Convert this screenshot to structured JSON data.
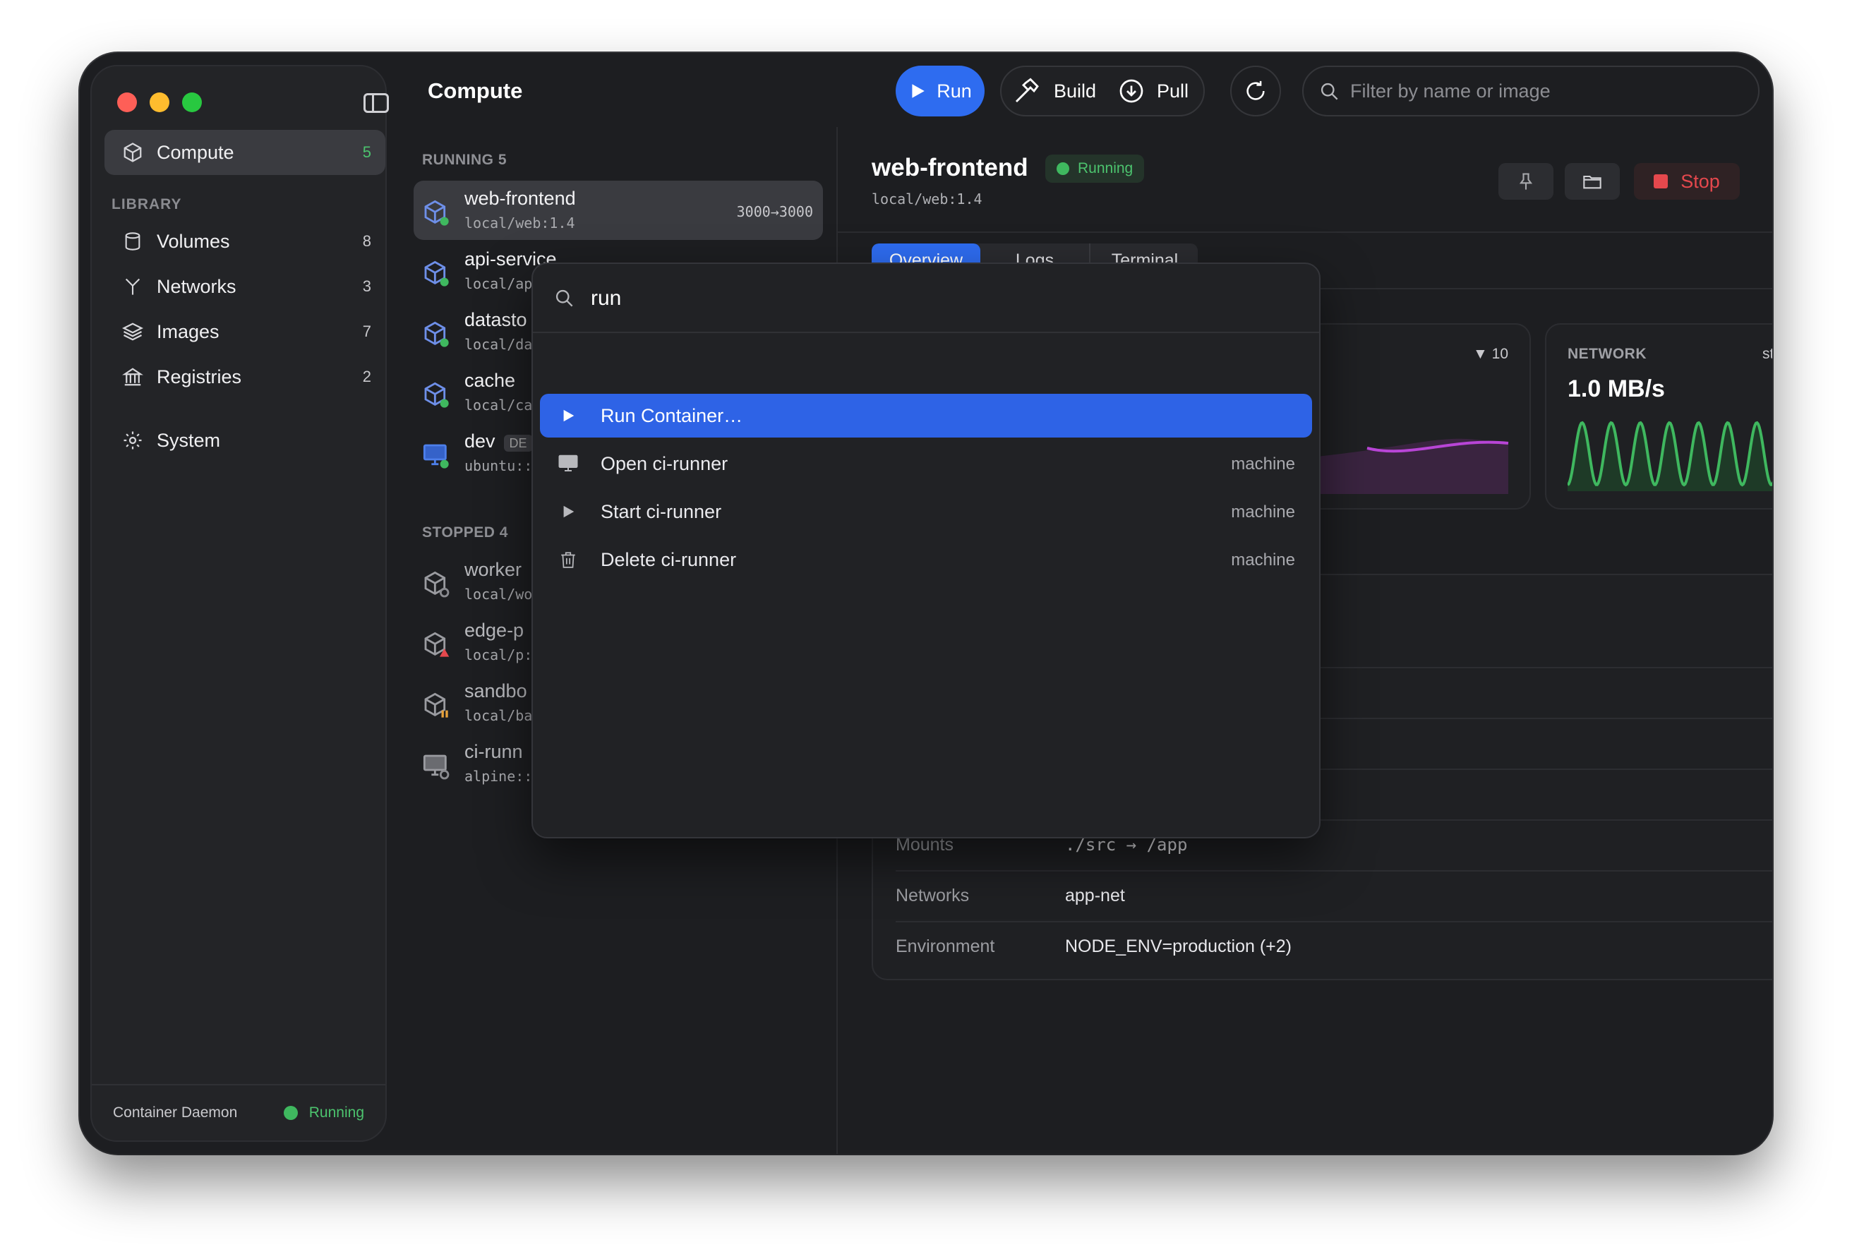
{
  "toolbar": {
    "title": "Compute",
    "run_label": "Run",
    "build_label": "Build",
    "pull_label": "Pull",
    "search_placeholder": "Filter by name or image"
  },
  "sidebar": {
    "compute": {
      "label": "Compute",
      "count": "5"
    },
    "library_label": "LIBRARY",
    "library": [
      {
        "label": "Volumes",
        "count": "8"
      },
      {
        "label": "Networks",
        "count": "3"
      },
      {
        "label": "Images",
        "count": "7"
      },
      {
        "label": "Registries",
        "count": "2"
      }
    ],
    "system_label": "System",
    "footer": {
      "label": "Container Daemon",
      "status": "Running"
    }
  },
  "containers": {
    "running_label": "RUNNING 5",
    "stopped_label": "STOPPED 4",
    "running": [
      {
        "name": "web-frontend",
        "image": "local/web:1.4",
        "port": "3000→3000"
      },
      {
        "name": "api-service",
        "image": "local/ap"
      },
      {
        "name": "datasto",
        "image": "local/da"
      },
      {
        "name": "cache",
        "image": "local/ca"
      },
      {
        "name": "dev",
        "image": "ubuntu::",
        "badge": "DE"
      }
    ],
    "stopped": [
      {
        "name": "worker",
        "image": "local/wo"
      },
      {
        "name": "edge-p",
        "image": "local/p:"
      },
      {
        "name": "sandbo",
        "image": "local/ba"
      },
      {
        "name": "ci-runn",
        "image": "alpine::"
      }
    ]
  },
  "detail": {
    "name": "web-frontend",
    "status": "Running",
    "image": "local/web:1.4",
    "stop_label": "Stop",
    "tabs": [
      "Overview",
      "Logs",
      "Terminal"
    ],
    "metric_partial": "▼ 10",
    "network": {
      "label": "NETWORK",
      "trend": "stable",
      "value": "1.0 MB/s"
    },
    "info": [
      {
        "key": "Mounts",
        "value": "./src → /app"
      },
      {
        "key": "Networks",
        "value": "app-net"
      },
      {
        "key": "Environment",
        "value": "NODE_ENV=production (+2)"
      }
    ]
  },
  "palette": {
    "query": "run",
    "items": [
      {
        "label": "Run Container…",
        "kind": "",
        "icon": "play-icon"
      },
      {
        "label": "Open ci-runner",
        "kind": "machine",
        "icon": "monitor-icon"
      },
      {
        "label": "Start ci-runner",
        "kind": "machine",
        "icon": "play-icon"
      },
      {
        "label": "Delete ci-runner",
        "kind": "machine",
        "icon": "trash-icon"
      }
    ]
  },
  "colors": {
    "accent": "#2e6cf0",
    "running": "#3fb85f",
    "stop": "#e5484d",
    "cpu_series": "#b845d6",
    "network_series": "#3fb85f"
  }
}
